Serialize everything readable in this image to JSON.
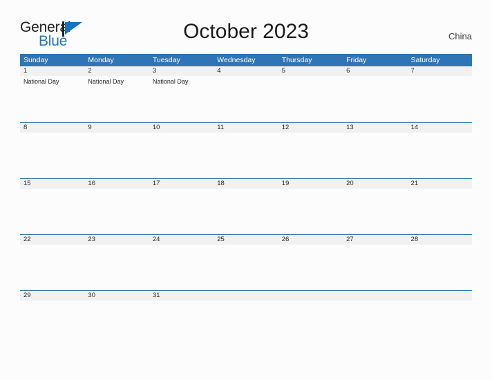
{
  "brand": {
    "name_part1": "General",
    "name_part2": "Blue",
    "logo_icon": "general-blue-triangle-logo"
  },
  "header": {
    "title": "October 2023",
    "region": "China"
  },
  "calendar": {
    "weekdays": [
      "Sunday",
      "Monday",
      "Tuesday",
      "Wednesday",
      "Thursday",
      "Friday",
      "Saturday"
    ],
    "weeks": [
      {
        "days": [
          {
            "number": "1",
            "events": [
              "National Day"
            ]
          },
          {
            "number": "2",
            "events": [
              "National Day"
            ]
          },
          {
            "number": "3",
            "events": [
              "National Day"
            ]
          },
          {
            "number": "4",
            "events": []
          },
          {
            "number": "5",
            "events": []
          },
          {
            "number": "6",
            "events": []
          },
          {
            "number": "7",
            "events": []
          }
        ]
      },
      {
        "days": [
          {
            "number": "8",
            "events": []
          },
          {
            "number": "9",
            "events": []
          },
          {
            "number": "10",
            "events": []
          },
          {
            "number": "11",
            "events": []
          },
          {
            "number": "12",
            "events": []
          },
          {
            "number": "13",
            "events": []
          },
          {
            "number": "14",
            "events": []
          }
        ]
      },
      {
        "days": [
          {
            "number": "15",
            "events": []
          },
          {
            "number": "16",
            "events": []
          },
          {
            "number": "17",
            "events": []
          },
          {
            "number": "18",
            "events": []
          },
          {
            "number": "19",
            "events": []
          },
          {
            "number": "20",
            "events": []
          },
          {
            "number": "21",
            "events": []
          }
        ]
      },
      {
        "days": [
          {
            "number": "22",
            "events": []
          },
          {
            "number": "23",
            "events": []
          },
          {
            "number": "24",
            "events": []
          },
          {
            "number": "25",
            "events": []
          },
          {
            "number": "26",
            "events": []
          },
          {
            "number": "27",
            "events": []
          },
          {
            "number": "28",
            "events": []
          }
        ]
      },
      {
        "days": [
          {
            "number": "29",
            "events": []
          },
          {
            "number": "30",
            "events": []
          },
          {
            "number": "31",
            "events": []
          },
          {
            "number": "",
            "events": []
          },
          {
            "number": "",
            "events": []
          },
          {
            "number": "",
            "events": []
          },
          {
            "number": "",
            "events": []
          }
        ]
      }
    ]
  },
  "colors": {
    "header_blue": "#2f75b5",
    "row_gray": "#f1f1f1",
    "brand_blue": "#1574bd",
    "page_background": "#fcfcfd"
  }
}
